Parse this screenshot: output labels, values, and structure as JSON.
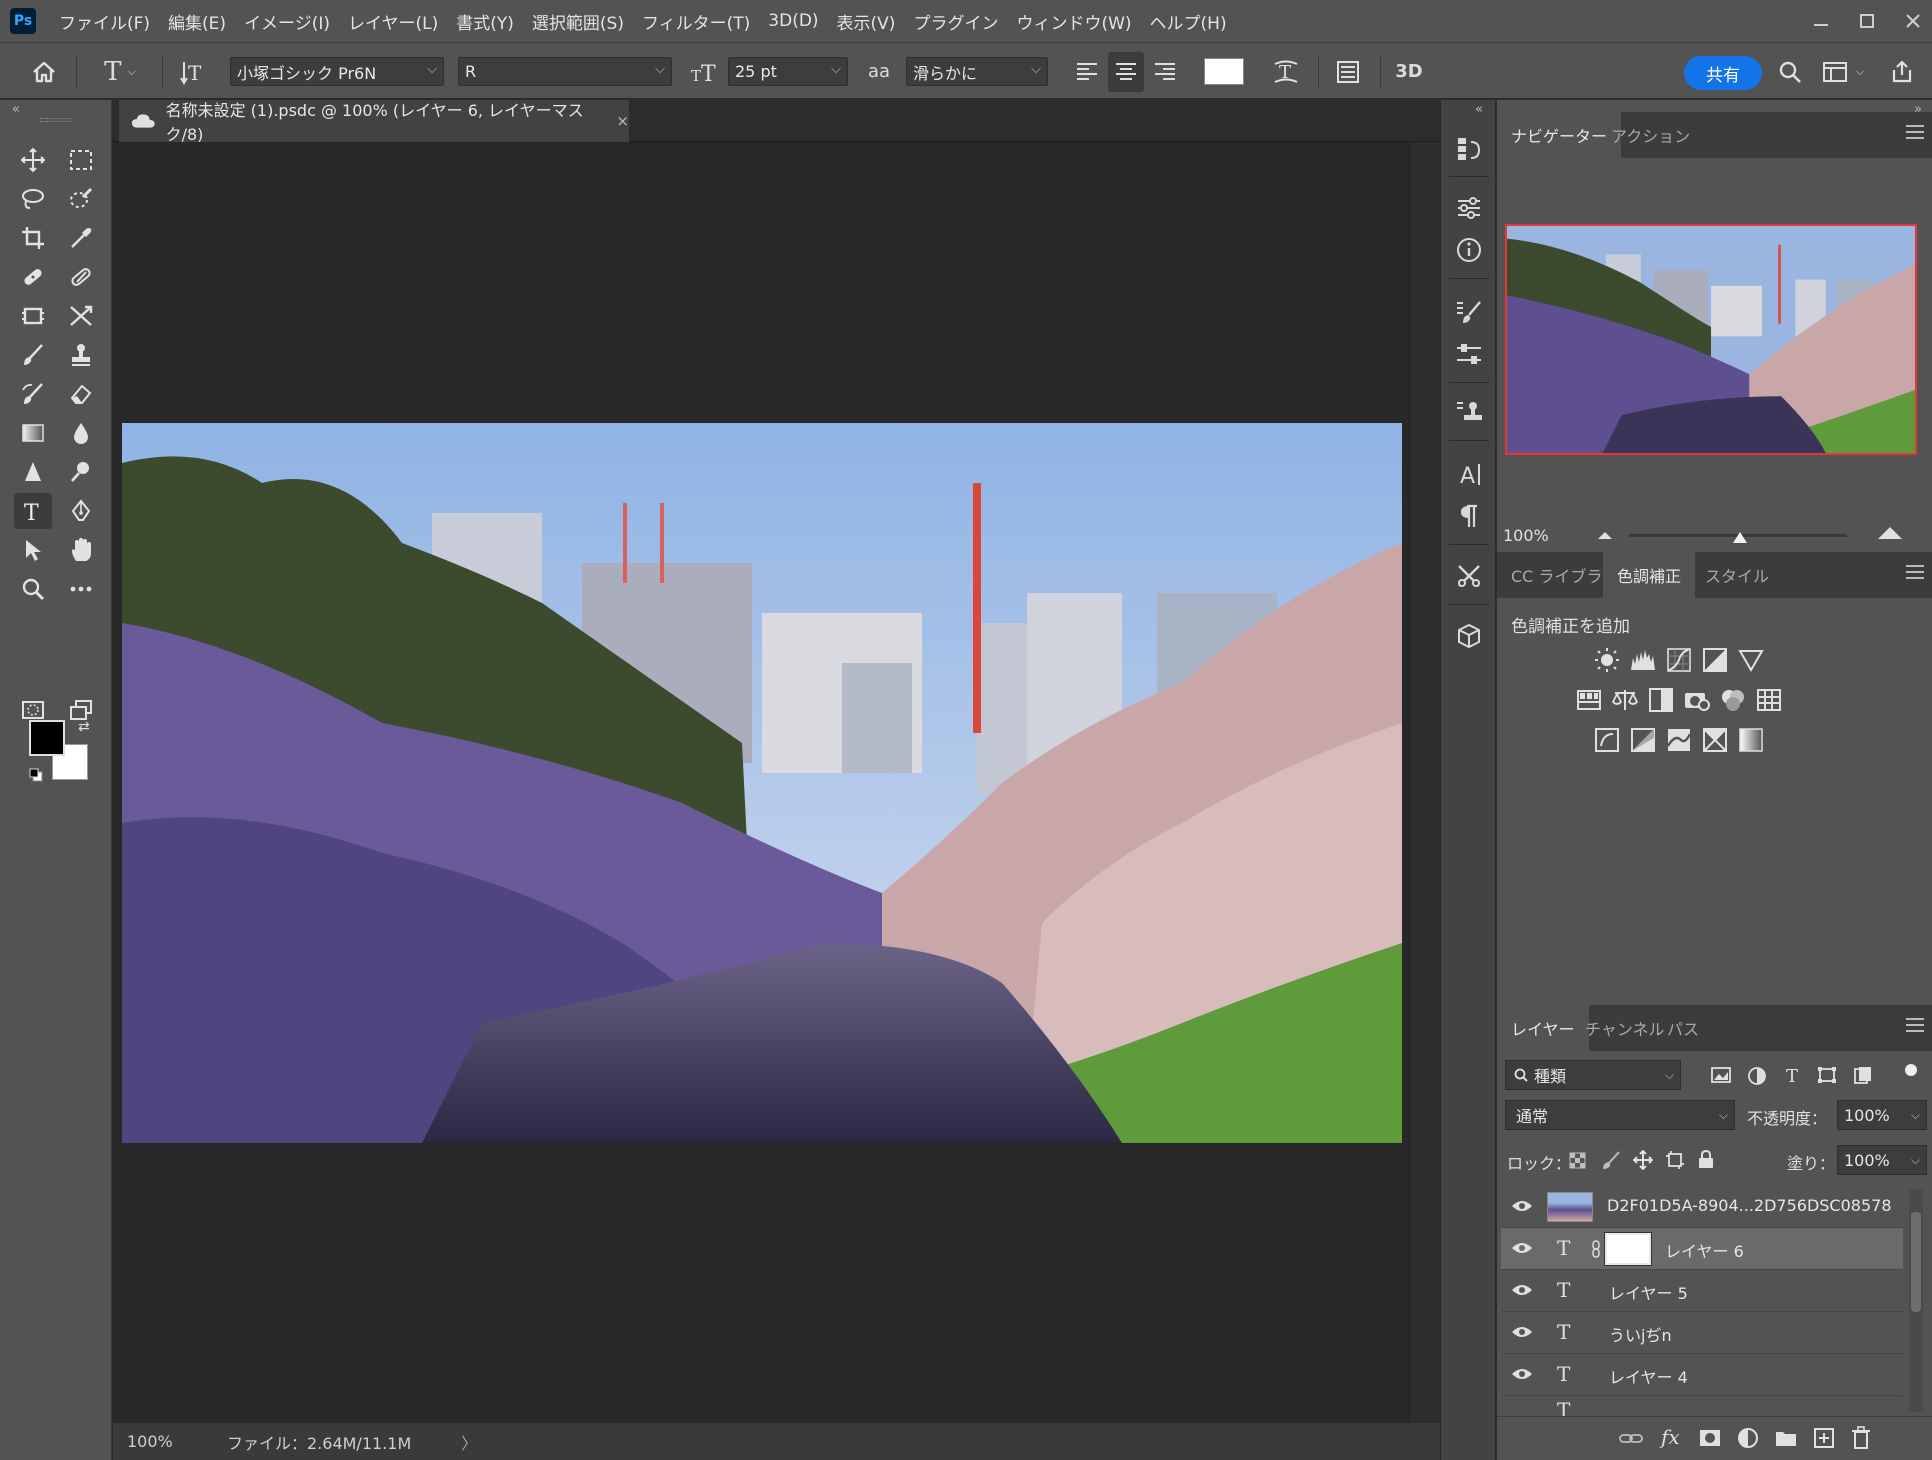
{
  "app": {
    "logo": "Ps"
  },
  "menu": [
    "ファイル(F)",
    "編集(E)",
    "イメージ(I)",
    "レイヤー(L)",
    "書式(Y)",
    "選択範囲(S)",
    "フィルター(T)",
    "3D(D)",
    "表示(V)",
    "プラグイン",
    "ウィンドウ(W)",
    "ヘルプ(H)"
  ],
  "window_controls": [
    "minimize-icon",
    "maximize-icon",
    "close-icon"
  ],
  "options": {
    "font_family": "小塚ゴシック Pr6N",
    "font_style": "R",
    "font_size": "25 pt",
    "aa_label": "aa",
    "antialias": "滑らかに",
    "threed_label": "3D",
    "share": "共有",
    "text_color": "#ffffff"
  },
  "document": {
    "tab_title": "名称未設定 (1).psdc @ 100% (レイヤー 6, レイヤーマスク/8)",
    "close": "×",
    "status_zoom": "100%",
    "status_file": "ファイル：2.64M/11.1M",
    "status_arrow": "〉"
  },
  "tools": [
    "move-tool-icon",
    "marquee-tool-icon",
    "lasso-tool-icon",
    "quick-select-tool-icon",
    "crop-tool-icon",
    "eyedropper-tool-icon",
    "healing-brush-icon",
    "patch-tool-icon",
    "frame-tool-icon",
    "transform-tool-icon",
    "brush-tool-icon",
    "stamp-tool-icon",
    "history-brush-icon",
    "eraser-tool-icon",
    "gradient-tool-icon",
    "blur-tool-icon",
    "sharpen-tool-icon",
    "dodge-tool-icon",
    "type-tool-icon",
    "pen-tool-icon",
    "path-select-tool-icon",
    "hand-tool-icon",
    "zoom-tool-icon",
    "more-tools-icon"
  ],
  "foreground_color": "#000000",
  "background_color": "#ffffff",
  "navigator": {
    "tabs": [
      "ナビゲーター",
      "アクション"
    ],
    "zoom": "100%",
    "zoom_slider_fraction": 0.51
  },
  "adjustments": {
    "tabs": [
      "CC ライブラリ",
      "色調補正",
      "スタイル"
    ],
    "heading": "色調補正を追加"
  },
  "layers_panel": {
    "tabs": [
      "レイヤー",
      "チャンネル",
      "パス"
    ],
    "filter": "種類",
    "blend_mode": "通常",
    "opacity_label": "不透明度：",
    "opacity": "100%",
    "lock_label": "ロック：",
    "fill_label": "塗り：",
    "fill": "100%",
    "layers": [
      {
        "name": "D2F01D5A-8904...2D756DSC08578",
        "kind": "image"
      },
      {
        "name": "レイヤー 6",
        "kind": "text",
        "selected": true
      },
      {
        "name": "レイヤー 5",
        "kind": "text"
      },
      {
        "name": "ういjぢn",
        "kind": "text"
      },
      {
        "name": "レイヤー 4",
        "kind": "text"
      }
    ]
  },
  "accent": "#1473e6",
  "nav_highlight": "#e8353a"
}
